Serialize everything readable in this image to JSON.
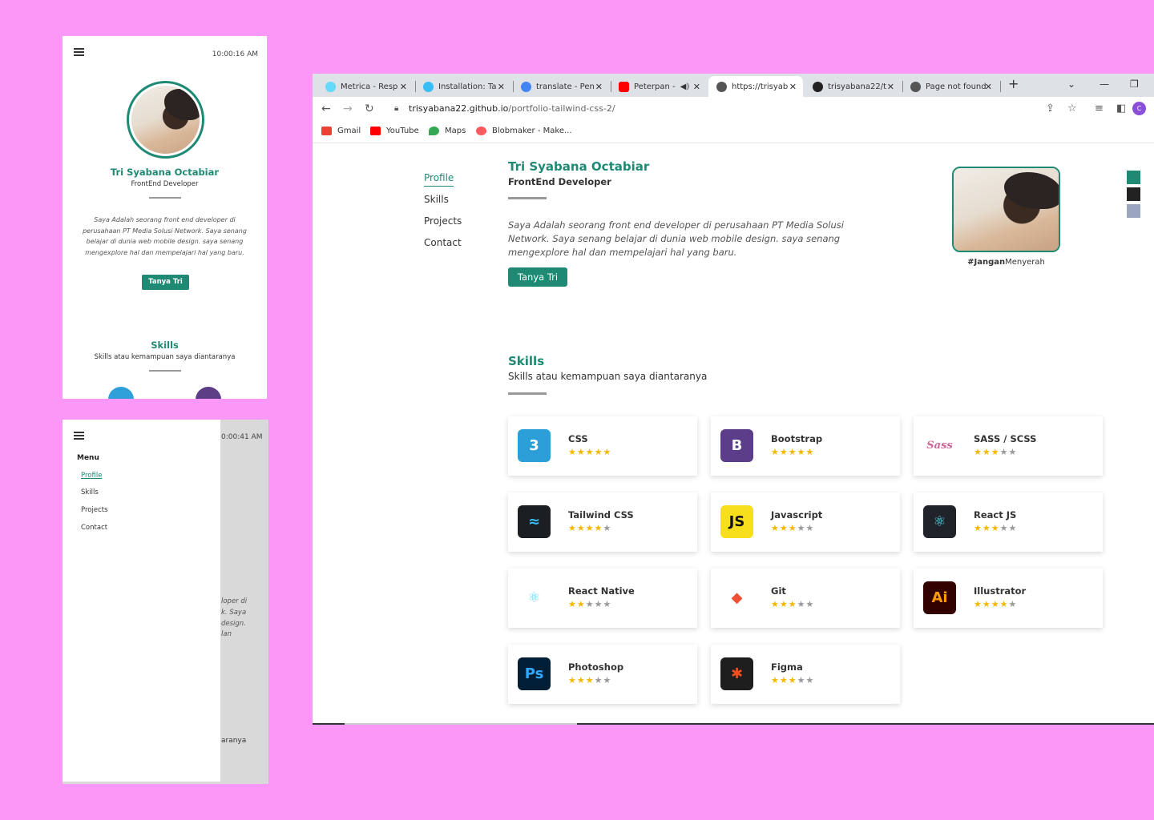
{
  "phone_profile": {
    "clock": "10:00:16 AM",
    "name": "Tri Syabana Octabiar",
    "role": "FrontEnd Developer",
    "bio": "Saya Adalah seorang front end developer di perusahaan PT Media Solusi Network. Saya senang belajar di dunia web mobile design. saya senang mengexplore hal dan mempelajari hal yang baru.",
    "button": "Tanya Tri",
    "skills_title": "Skills",
    "skills_sub": "Skills atau kemampuan saya diantaranya"
  },
  "phone_menu": {
    "clock": "0:00:41 AM",
    "menu_title": "Menu",
    "items": [
      "Profile",
      "Skills",
      "Projects",
      "Contact"
    ],
    "ghost_lines": [
      "loper di",
      "k. Saya",
      "design.",
      "lan"
    ],
    "ghost_bottom": "aranya"
  },
  "browser": {
    "tabs": [
      {
        "title": "Metrica - Resp",
        "icon": "react-icon",
        "color": "#61dafb"
      },
      {
        "title": "Installation: Ta",
        "icon": "tailwind-icon",
        "color": "#38bdf8"
      },
      {
        "title": "translate - Pen",
        "icon": "google-icon",
        "color": "#4285f4"
      },
      {
        "title": "Peterpan -",
        "icon": "youtube-icon",
        "color": "#ff0000"
      },
      {
        "title": "https://trisyab",
        "icon": "globe-icon",
        "color": "#555555"
      },
      {
        "title": "trisyabana22/t",
        "icon": "github-icon",
        "color": "#222222"
      },
      {
        "title": "Page not found",
        "icon": "globe-icon",
        "color": "#555555"
      }
    ],
    "url_host": "trisyabana22.github.io",
    "url_path": "/portfolio-tailwind-css-2/",
    "profile_initial": "C",
    "bookmarks": [
      {
        "label": "Gmail",
        "color": "#ea4335"
      },
      {
        "label": "YouTube",
        "color": "#ff0000"
      },
      {
        "label": "Maps",
        "color": "#34a853"
      },
      {
        "label": "Blobmaker - Make...",
        "color": "#ff5a5f"
      }
    ]
  },
  "site": {
    "nav": [
      "Profile",
      "Skills",
      "Projects",
      "Contact"
    ],
    "name": "Tri Syabana Octabiar",
    "role": "FrontEnd Developer",
    "bio": "Saya Adalah seorang front end developer di perusahaan PT Media Solusi Network. Saya senang belajar di dunia web mobile design. saya senang mengexplore hal dan mempelajari hal yang baru.",
    "button": "Tanya Tri",
    "tag_bold": "#Jangan",
    "tag_rest": "Menyerah",
    "swatches": [
      "#1f8a74",
      "#222222",
      "#9aa6bf"
    ],
    "skills_title": "Skills",
    "skills_sub": "Skills atau kemampuan saya diantaranya",
    "skills": [
      {
        "name": "CSS",
        "rating": 5,
        "logo_text": "3",
        "logo_bg": "#2a9fd8",
        "logo_fg": "#ffffff"
      },
      {
        "name": "Bootstrap",
        "rating": 5,
        "logo_text": "B",
        "logo_bg": "#5b3d8a",
        "logo_fg": "#ffffff"
      },
      {
        "name": "SASS / SCSS",
        "rating": 3,
        "logo_text": "Sass",
        "logo_bg": "#ffffff",
        "logo_fg": "#cd6799"
      },
      {
        "name": "Tailwind CSS",
        "rating": 4,
        "logo_text": "≈",
        "logo_bg": "#1b1f24",
        "logo_fg": "#38bdf8"
      },
      {
        "name": "Javascript",
        "rating": 3,
        "logo_text": "JS",
        "logo_bg": "#f7df1e",
        "logo_fg": "#111111"
      },
      {
        "name": "React JS",
        "rating": 3,
        "logo_text": "⚛",
        "logo_bg": "#20232a",
        "logo_fg": "#61dafb"
      },
      {
        "name": "React Native",
        "rating": 2,
        "logo_text": "⚛",
        "logo_bg": "#ffffff",
        "logo_fg": "#61dafb"
      },
      {
        "name": "Git",
        "rating": 3,
        "logo_text": "◆",
        "logo_bg": "#ffffff",
        "logo_fg": "#f05033"
      },
      {
        "name": "Illustrator",
        "rating": 4,
        "logo_text": "Ai",
        "logo_bg": "#330000",
        "logo_fg": "#ff9a00"
      },
      {
        "name": "Photoshop",
        "rating": 3,
        "logo_text": "Ps",
        "logo_bg": "#001e36",
        "logo_fg": "#31a8ff"
      },
      {
        "name": "Figma",
        "rating": 3,
        "logo_text": "✱",
        "logo_bg": "#1e1e1e",
        "logo_fg": "#f24e1e"
      }
    ]
  }
}
